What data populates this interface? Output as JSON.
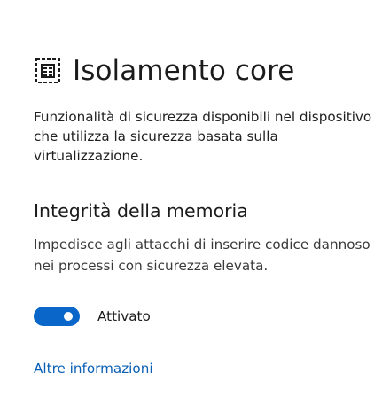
{
  "header": {
    "icon": "core-isolation-chip-icon",
    "title": "Isolamento core"
  },
  "description": "Funzionalità di sicurezza disponibili nel dispositivo che utilizza la sicurezza basata sulla virtualizzazione.",
  "memory_integrity": {
    "title": "Integrità della memoria",
    "description": "Impedisce agli attacchi di inserire codice dannoso nei processi con sicurezza elevata.",
    "toggle": {
      "state": "on",
      "label": "Attivato",
      "accent_color": "#0a66c8"
    }
  },
  "links": {
    "more_info": "Altre informazioni",
    "link_color": "#0a5fb4"
  }
}
